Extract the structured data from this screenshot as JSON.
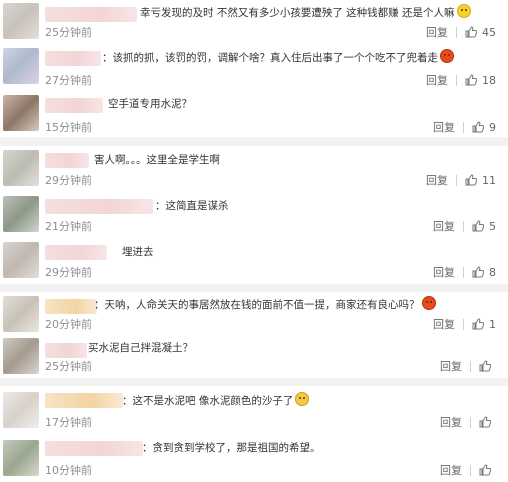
{
  "reply_label": "回复",
  "comments": [
    {
      "text_pre": "幸亏发现的及时 不然又有多少小孩要遭殃了 这种钱都赚 还是个人嘛",
      "emoji": "smile-emoji",
      "time": "25分钟前",
      "likes": "45"
    },
    {
      "text_pre": "：该抓的抓，该罚的罚，调解个啥？真入住后出事了一个个吃不了兜着走",
      "emoji": "angry-emoji",
      "time": "27分钟前",
      "likes": "18"
    },
    {
      "text_pre": "空手道专用水泥？",
      "emoji": "",
      "time": "15分钟前",
      "likes": "9"
    },
    {
      "text_pre": "害人啊。。。这里全是学生啊",
      "emoji": "",
      "time": "29分钟前",
      "likes": "11"
    },
    {
      "text_pre": "：这简直是谋杀",
      "emoji": "",
      "time": "21分钟前",
      "likes": "5"
    },
    {
      "text_pre": "埋进去",
      "emoji": "",
      "time": "29分钟前",
      "likes": "8"
    },
    {
      "text_pre": "：天呐，人命关天的事居然放在钱的面前不值一提，商家还有良心吗？",
      "emoji": "angry-emoji",
      "time": "20分钟前",
      "likes": "1"
    },
    {
      "text_pre": "买水泥自己拌混凝土？",
      "emoji": "",
      "time": "25分钟前",
      "likes": ""
    },
    {
      "text_pre": "：这不是水泥吧 像水泥颜色的沙子了",
      "emoji": "embarrassed-emoji",
      "time": "17分钟前",
      "likes": ""
    },
    {
      "text_pre": "：贪到贪到学校了，那是祖国的希望。",
      "emoji": "",
      "time": "10分钟前",
      "likes": ""
    }
  ]
}
